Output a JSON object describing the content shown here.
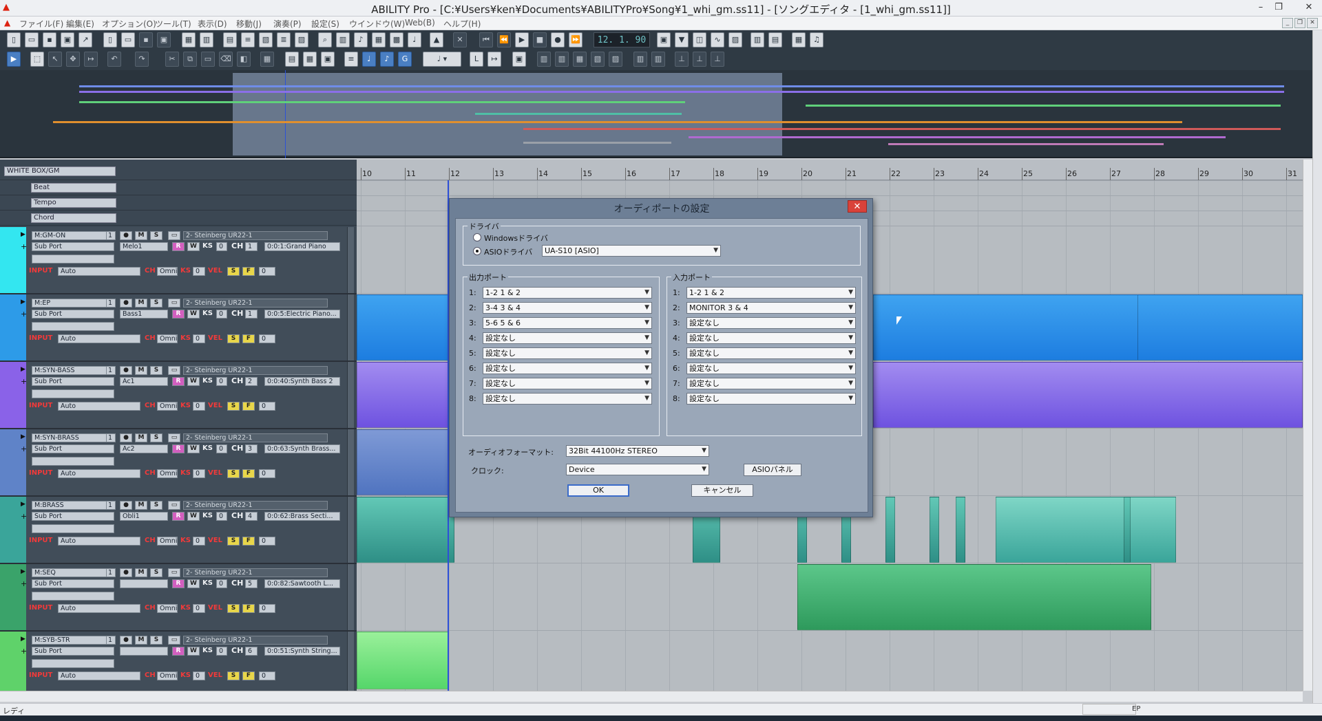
{
  "window": {
    "title": "ABILITY Pro - [C:¥Users¥ken¥Documents¥ABILITYPro¥Song¥1_whi_gm.ss11] - [ソングエディタ - [1_whi_gm.ss11]]",
    "menu": [
      "ファイル(F)",
      "編集(E)",
      "オプション(O)",
      "ツール(T)",
      "表示(D)",
      "移動(J)",
      "演奏(P)",
      "設定(S)",
      "ウインドウ(W)",
      "Web(B)",
      "ヘルプ(H)"
    ]
  },
  "transport": {
    "counter": "12. 1. 90"
  },
  "track_panel": {
    "header": "WHITE BOX/GM",
    "meta_tracks": [
      "Beat",
      "Tempo",
      "Chord"
    ],
    "tracks": [
      {
        "name": "M:GM-ON",
        "num": "1",
        "port": "2- Steinberg UR22-1",
        "sub_port": "Sub Port",
        "part": "Melo1",
        "ks": "0",
        "ch": "1",
        "program": "0:0:1:Grand Piano",
        "input": "INPUT",
        "input_val": "Auto",
        "ch_label": "CH",
        "ch_val": "Omni",
        "ks_label": "KS",
        "ks_val": "0",
        "vel_label": "VEL",
        "vel_val": "0",
        "color": "#33e6f0"
      },
      {
        "name": "M:EP",
        "num": "1",
        "port": "2- Steinberg UR22-1",
        "sub_port": "Sub Port",
        "part": "Bass1",
        "ks": "0",
        "ch": "1",
        "program": "0:0:5:Electric Piano...",
        "input": "INPUT",
        "input_val": "Auto",
        "ch_label": "CH",
        "ch_val": "Omni",
        "ks_label": "KS",
        "ks_val": "0",
        "vel_label": "VEL",
        "vel_val": "0",
        "color": "#2d9be8"
      },
      {
        "name": "M:SYN-BASS",
        "num": "1",
        "port": "2- Steinberg UR22-1",
        "sub_port": "Sub Port",
        "part": "Ac1",
        "ks": "0",
        "ch": "2",
        "program": "0:0:40:Synth Bass 2",
        "input": "INPUT",
        "input_val": "Auto",
        "ch_label": "CH",
        "ch_val": "Omni",
        "ks_label": "KS",
        "ks_val": "0",
        "vel_label": "VEL",
        "vel_val": "0",
        "color": "#8a62e8"
      },
      {
        "name": "M:SYN-BRASS",
        "num": "1",
        "port": "2- Steinberg UR22-1",
        "sub_port": "Sub Port",
        "part": "Ac2",
        "ks": "0",
        "ch": "3",
        "program": "0:0:63:Synth Brass...",
        "input": "INPUT",
        "input_val": "Auto",
        "ch_label": "CH",
        "ch_val": "Omni",
        "ks_label": "KS",
        "ks_val": "0",
        "vel_label": "VEL",
        "vel_val": "0",
        "color": "#5f83c8"
      },
      {
        "name": "M:BRASS",
        "num": "1",
        "port": "2- Steinberg UR22-1",
        "sub_port": "Sub Port",
        "part": "Obli1",
        "ks": "0",
        "ch": "4",
        "program": "0:0:62:Brass Secti...",
        "input": "INPUT",
        "input_val": "Auto",
        "ch_label": "CH",
        "ch_val": "Omni",
        "ks_label": "KS",
        "ks_val": "0",
        "vel_label": "VEL",
        "vel_val": "0",
        "color": "#3aa59a"
      },
      {
        "name": "M:SEQ",
        "num": "1",
        "port": "2- Steinberg UR22-1",
        "sub_port": "Sub Port",
        "part": "",
        "ks": "0",
        "ch": "5",
        "program": "0:0:82:Sawtooth L...",
        "input": "INPUT",
        "input_val": "Auto",
        "ch_label": "CH",
        "ch_val": "Omni",
        "ks_label": "KS",
        "ks_val": "0",
        "vel_label": "VEL",
        "vel_val": "0",
        "color": "#3aa36a"
      },
      {
        "name": "M:SYB-STR",
        "num": "1",
        "port": "2- Steinberg UR22-1",
        "sub_port": "Sub Port",
        "part": "",
        "ks": "0",
        "ch": "6",
        "program": "0:0:51:Synth String...",
        "input": "INPUT",
        "input_val": "Auto",
        "ch_label": "CH",
        "ch_val": "Omni",
        "ks_label": "KS",
        "ks_val": "0",
        "vel_label": "VEL",
        "vel_val": "0",
        "color": "#5fd26a"
      }
    ]
  },
  "ruler": {
    "bars": [
      "10",
      "11",
      "12",
      "13",
      "14",
      "15",
      "16",
      "17",
      "18",
      "19",
      "20",
      "21",
      "22",
      "23",
      "24",
      "25",
      "26",
      "27",
      "28",
      "29",
      "30",
      "31"
    ]
  },
  "dialog": {
    "title": "オーディポートの設定",
    "driver_group": "ドライバ",
    "driver_windows": "Windowsドライバ",
    "driver_asio": "ASIOドライバ",
    "asio_device": "UA-S10 [ASIO]",
    "output_group": "出力ポート",
    "input_group": "入力ポート",
    "output_ports": [
      {
        "n": "1:",
        "v": "1-2 1 & 2"
      },
      {
        "n": "2:",
        "v": "3-4 3 & 4"
      },
      {
        "n": "3:",
        "v": "5-6 5 & 6"
      },
      {
        "n": "4:",
        "v": "設定なし"
      },
      {
        "n": "5:",
        "v": "設定なし"
      },
      {
        "n": "6:",
        "v": "設定なし"
      },
      {
        "n": "7:",
        "v": "設定なし"
      },
      {
        "n": "8:",
        "v": "設定なし"
      }
    ],
    "input_ports": [
      {
        "n": "1:",
        "v": "1-2 1 & 2"
      },
      {
        "n": "2:",
        "v": "MONITOR 3 & 4"
      },
      {
        "n": "3:",
        "v": "設定なし"
      },
      {
        "n": "4:",
        "v": "設定なし"
      },
      {
        "n": "5:",
        "v": "設定なし"
      },
      {
        "n": "6:",
        "v": "設定なし"
      },
      {
        "n": "7:",
        "v": "設定なし"
      },
      {
        "n": "8:",
        "v": "設定なし"
      }
    ],
    "format_label": "オーディオフォーマット:",
    "format_value": "32Bit 44100Hz STEREO",
    "clock_label": "クロック:",
    "clock_value": "Device",
    "asio_panel": "ASIOパネル",
    "ok": "OK",
    "cancel": "キャンセル"
  },
  "status": {
    "left": "レディ",
    "ep": "EP"
  }
}
